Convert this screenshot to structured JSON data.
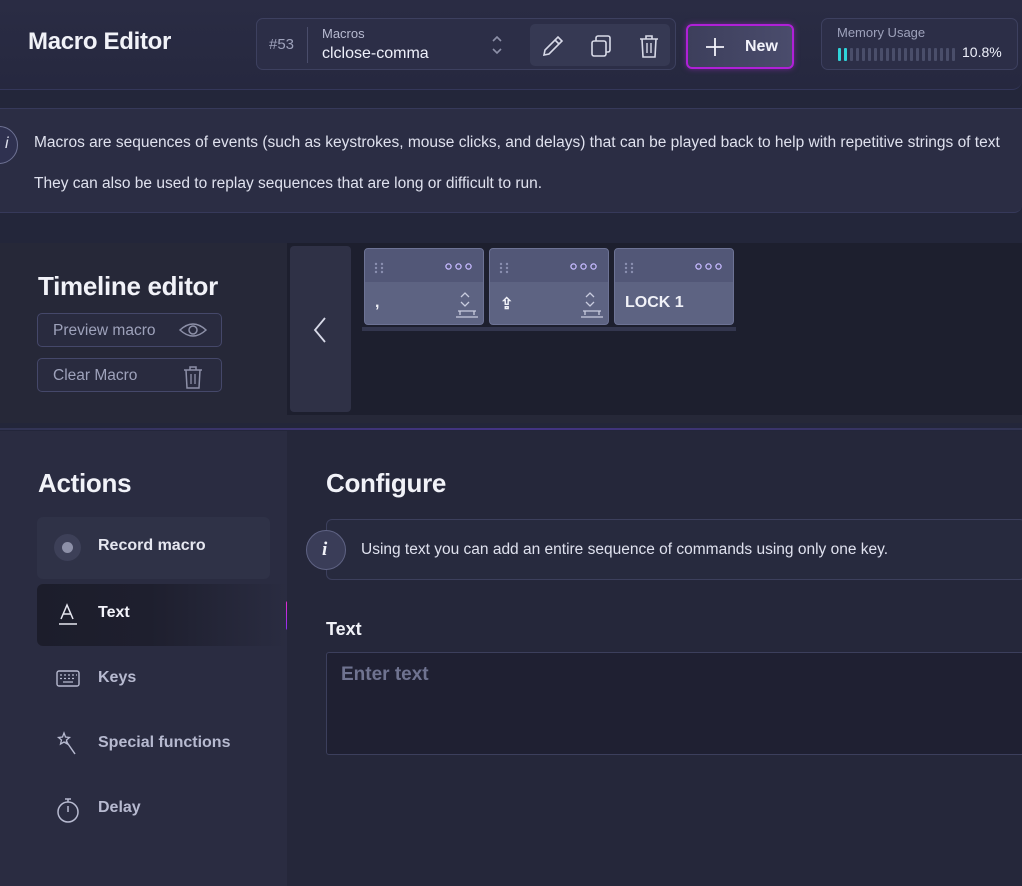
{
  "header": {
    "title": "Macro Editor",
    "macro_number": "#53",
    "macro_label": "Macros",
    "macro_selected": "clclose-comma",
    "new_label": "New",
    "memory_label": "Memory Usage",
    "memory_value": "10.8%",
    "memory_fraction": 0.108
  },
  "info": {
    "line1": "Macros are sequences of events (such as keystrokes, mouse clicks, and delays) that can be played back to help with repetitive strings of text",
    "line2": "They can also be used to replay sequences that are long or difficult to run."
  },
  "timeline": {
    "title": "Timeline editor",
    "preview_label": "Preview macro",
    "clear_label": "Clear Macro",
    "cards": [
      {
        "label": ","
      },
      {
        "label": "⇪"
      },
      {
        "label": "LOCK 1"
      }
    ]
  },
  "actions": {
    "title": "Actions",
    "items": [
      {
        "label": "Record macro"
      },
      {
        "label": "Text"
      },
      {
        "label": "Keys"
      },
      {
        "label": "Special functions"
      },
      {
        "label": "Delay"
      }
    ]
  },
  "configure": {
    "title": "Configure",
    "info_text": "Using text you can add an entire sequence of commands using only one key.",
    "text_label": "Text",
    "text_placeholder": "Enter text",
    "text_value": ""
  },
  "colors": {
    "accent": "#b020d8",
    "memory_bar": "#2fd3d9",
    "background": "#23263a"
  }
}
